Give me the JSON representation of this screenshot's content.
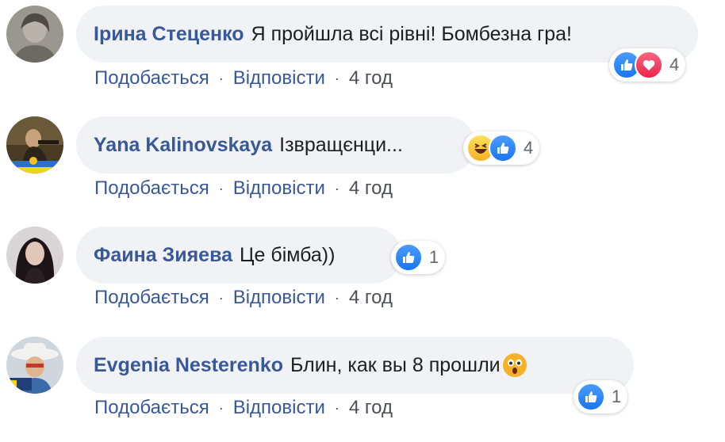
{
  "actions": {
    "like": "Подобається",
    "reply": "Відповісти",
    "sep": "·"
  },
  "comments": [
    {
      "author": "Ірина Стеценко",
      "text": "Я пройшла всі рівні! Бомбезна гра!",
      "time": "4 год",
      "reactions": [
        "like",
        "love"
      ],
      "reaction_count": "4"
    },
    {
      "author": "Yana Kalinovskaya",
      "text": "Ізвращєнци...",
      "time": "4 год",
      "reactions": [
        "haha",
        "like"
      ],
      "reaction_count": "4"
    },
    {
      "author": "Фаина Зияева",
      "text": "Це бімба))",
      "time": "4 год",
      "reactions": [
        "like"
      ],
      "reaction_count": "1"
    },
    {
      "author": "Evgenia Nesterenko",
      "text": "Блин, как вы 8 прошли",
      "time": "4 год",
      "reactions": [
        "like"
      ],
      "reaction_count": "1",
      "text_emoji": "wow"
    }
  ],
  "colors": {
    "name": "#385898",
    "bubble": "#f0f2f5",
    "like": "#1877f2",
    "love": "#e8244a",
    "emoji": "#f7b125"
  }
}
